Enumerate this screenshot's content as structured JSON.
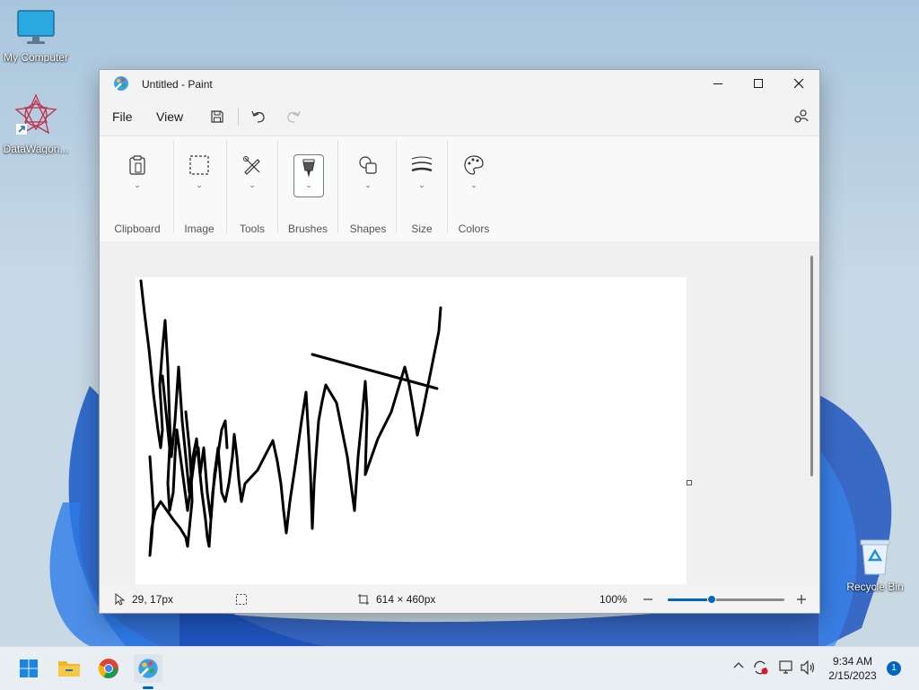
{
  "desktop": {
    "icons": [
      {
        "label": "My Computer"
      },
      {
        "label": "DataWagon..."
      },
      {
        "label": "Recycle Bin"
      }
    ]
  },
  "window": {
    "title": "Untitled - Paint",
    "menu": {
      "file": "File",
      "view": "View"
    },
    "ribbon": {
      "groups": [
        "Clipboard",
        "Image",
        "Tools",
        "Brushes",
        "Shapes",
        "Size",
        "Colors"
      ]
    },
    "status": {
      "cursor_pos": "29, 17px",
      "canvas_size": "614 × 460px",
      "zoom": "100%",
      "zoom_level_fraction": 0.38
    }
  },
  "taskbar": {
    "time": "9:34 AM",
    "date": "2/15/2023",
    "notification_count": "1"
  },
  "colors": {
    "accent": "#0067c0",
    "stroke": "#000000"
  }
}
